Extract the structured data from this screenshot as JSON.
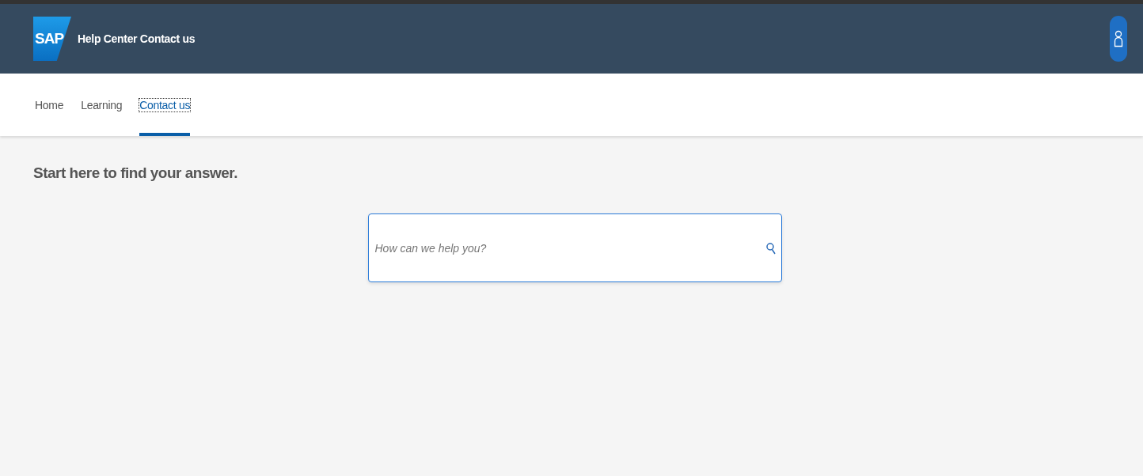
{
  "header": {
    "logo_text": "SAP",
    "title": "Help Center Contact us"
  },
  "tabs": [
    {
      "label": "Home",
      "selected": false
    },
    {
      "label": "Learning",
      "selected": false
    },
    {
      "label": "Contact us",
      "selected": true
    }
  ],
  "main": {
    "heading": "Start here to find your answer.",
    "search": {
      "placeholder": "How can we help you?"
    }
  }
}
